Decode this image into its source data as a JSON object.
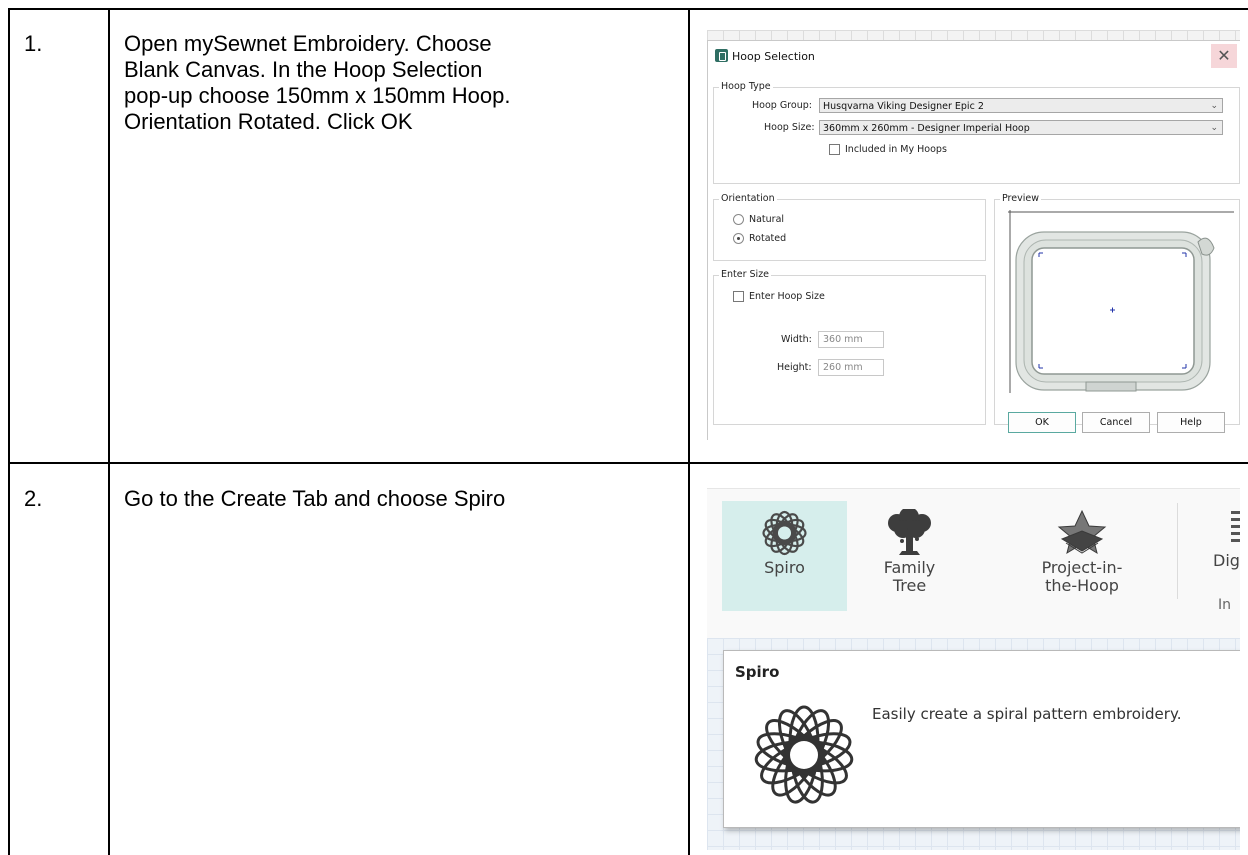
{
  "rows": [
    {
      "number": "1.",
      "instruction_lines": [
        "Open mySewnet Embroidery. Choose",
        "Blank Canvas. In the Hoop Selection",
        "pop-up choose 150mm x 150mm Hoop.",
        "Orientation Rotated. Click OK"
      ]
    },
    {
      "number": "2.",
      "instruction_lines": [
        "Go to the Create Tab and choose Spiro"
      ]
    }
  ],
  "hoop_dialog": {
    "title": "Hoop Selection",
    "close_glyph": "✕",
    "hoop_type_label": "Hoop Type",
    "hoop_group_label": "Hoop Group:",
    "hoop_group_value": "Husqvarna Viking Designer Epic 2",
    "hoop_size_label": "Hoop Size:",
    "hoop_size_value": "360mm x 260mm - Designer Imperial Hoop",
    "included_label": "Included in My Hoops",
    "orientation_label": "Orientation",
    "orientation_natural": "Natural",
    "orientation_rotated": "Rotated",
    "orientation_selected": "Rotated",
    "enter_size_label": "Enter Size",
    "enter_hoop_size_label": "Enter Hoop Size",
    "width_label": "Width:",
    "width_value": "360 mm",
    "height_label": "Height:",
    "height_value": "260 mm",
    "preview_label": "Preview",
    "ok_label": "OK",
    "cancel_label": "Cancel",
    "help_label": "Help",
    "chevron_icon": "chevron-down-icon",
    "accent_color": "#2f6e63"
  },
  "create_ribbon": {
    "items": [
      {
        "label_line1": "Spiro",
        "label_line2": "",
        "icon": "spiro-icon",
        "selected": true
      },
      {
        "label_line1": "Family",
        "label_line2": "Tree",
        "icon": "family-tree-icon",
        "selected": false
      },
      {
        "label_line1": "Project-in-",
        "label_line2": "the-Hoop",
        "icon": "project-in-the-hoop-icon",
        "selected": false
      }
    ],
    "clipped_label": "Digi",
    "clipped_group_label": "In",
    "selected_color": "#d6eeec"
  },
  "tooltip": {
    "title": "Spiro",
    "description": "Easily create a spiral pattern embroidery.",
    "icon": "spiro-icon"
  }
}
